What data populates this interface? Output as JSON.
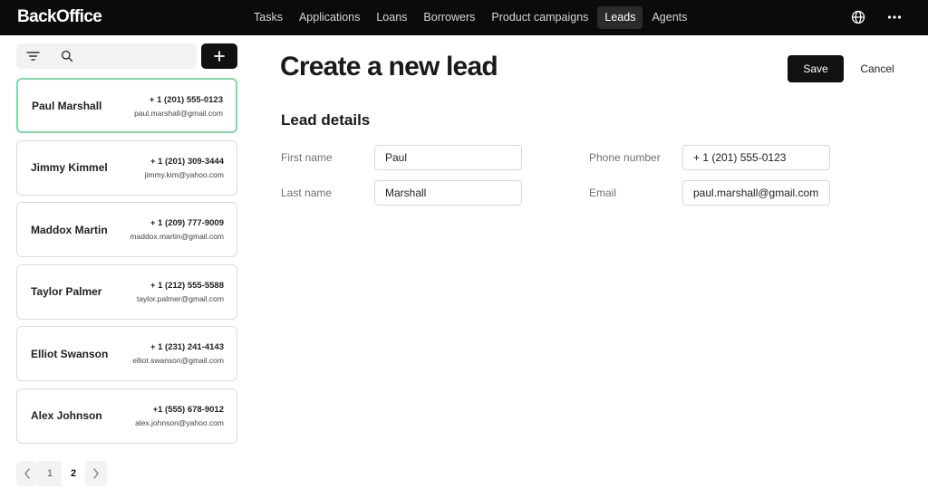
{
  "app": {
    "brand": "BackOffice"
  },
  "nav": {
    "items": [
      {
        "label": "Tasks"
      },
      {
        "label": "Applications"
      },
      {
        "label": "Loans"
      },
      {
        "label": "Borrowers"
      },
      {
        "label": "Product campaigns"
      },
      {
        "label": "Leads",
        "active": true
      },
      {
        "label": "Agents"
      }
    ],
    "icons": [
      "globe-icon",
      "more-icon"
    ]
  },
  "sidebar": {
    "search": {
      "value": "",
      "placeholder": ""
    },
    "icons": {
      "filter": "filter-icon",
      "search": "search-icon",
      "add": "plus-icon"
    },
    "leads": [
      {
        "name": "Paul Marshall",
        "phone": "+ 1 (201) 555-0123",
        "email": "paul.marshall@gmail.com",
        "selected": true
      },
      {
        "name": "Jimmy Kimmel",
        "phone": "+ 1 (201) 309-3444",
        "email": "jimmy.kim@yahoo.com"
      },
      {
        "name": "Maddox Martin",
        "phone": "+ 1 (209) 777-9009",
        "email": "maddox.martin@gmail.com"
      },
      {
        "name": "Taylor Palmer",
        "phone": "+ 1 (212) 555-5588",
        "email": "taylor.palmer@gmail.com"
      },
      {
        "name": "Elliot Swanson",
        "phone": "+ 1 (231) 241-4143",
        "email": "elliot.swanson@gmail.com"
      },
      {
        "name": "Alex Johnson",
        "phone": "+1 (555) 678-9012",
        "email": "alex.johnson@yahoo.com"
      }
    ],
    "pagination": {
      "pages": [
        "1",
        "2"
      ],
      "current": "2"
    }
  },
  "main": {
    "title": "Create a new lead",
    "save_label": "Save",
    "cancel_label": "Cancel",
    "section_title": "Lead details",
    "fields": {
      "first_name": {
        "label": "First name",
        "value": "Paul"
      },
      "last_name": {
        "label": "Last name",
        "value": "Marshall"
      },
      "phone": {
        "label": "Phone number",
        "value": "+ 1 (201) 555-0123"
      },
      "email": {
        "label": "Email",
        "value": "paul.marshall@gmail.com"
      }
    }
  },
  "colors": {
    "topbar": "#0b0b0b",
    "selected_border": "#7fd9a8",
    "primary_button": "#111111"
  }
}
